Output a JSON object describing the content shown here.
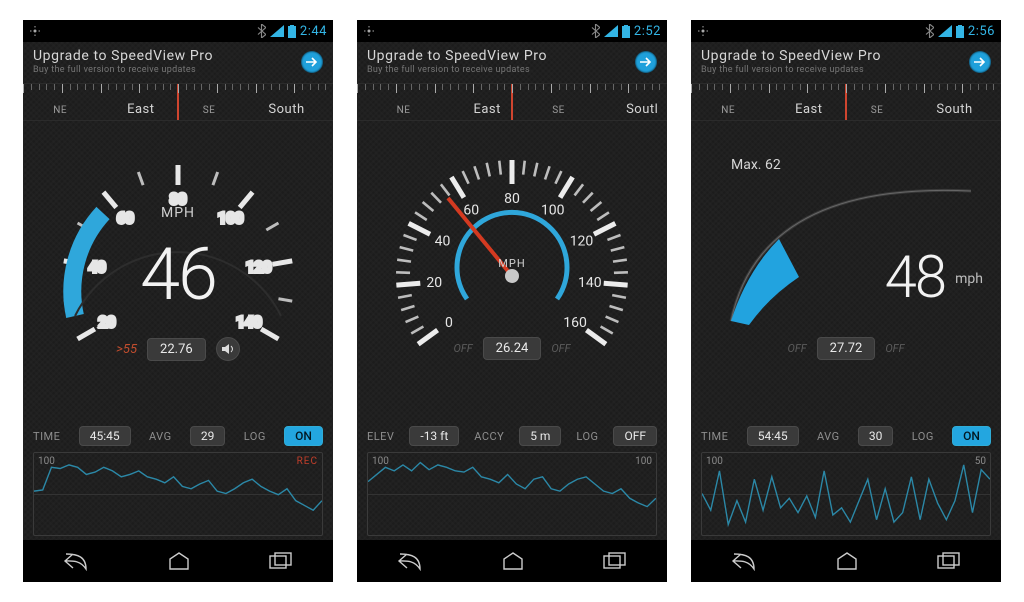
{
  "colors": {
    "accent": "#33b5e5",
    "warn": "#c04d2e"
  },
  "screens": [
    {
      "status": {
        "time": "2:44"
      },
      "upgrade": {
        "title": "Upgrade to SpeedView Pro",
        "subtitle": "Buy the full version to receive updates"
      },
      "compass": {
        "labels": [
          {
            "pos": 12,
            "text": "NE",
            "small": true
          },
          {
            "pos": 38,
            "text": "East"
          },
          {
            "pos": 60,
            "text": "SE",
            "small": true
          },
          {
            "pos": 85,
            "text": "South"
          }
        ]
      },
      "gauge": {
        "style": "digital",
        "unit": "MPH",
        "threshold": ">55",
        "ticks": [
          "20",
          "40",
          "60",
          "80",
          "100",
          "120",
          "140"
        ]
      },
      "speed": "46",
      "pill_center": "22.76",
      "horn": true,
      "stats": {
        "a_label": "TIME",
        "a_value": "45:45",
        "b_label": "AVG",
        "b_value": "29",
        "c_label": "LOG",
        "c_value": "ON",
        "c_on": true
      },
      "chart": {
        "ymax": "100",
        "right": "REC",
        "right_red": true,
        "points": [
          38,
          39,
          58,
          57,
          60,
          58,
          52,
          54,
          58,
          55,
          50,
          52,
          55,
          50,
          48,
          45,
          50,
          42,
          40,
          44,
          47,
          38,
          36,
          40,
          45,
          48,
          42,
          38,
          35,
          40,
          30,
          26,
          22,
          30
        ]
      }
    },
    {
      "status": {
        "time": "2:52"
      },
      "upgrade": {
        "title": "Upgrade to SpeedView Pro",
        "subtitle": "Buy the full version to receive updates"
      },
      "compass": {
        "labels": [
          {
            "pos": 15,
            "text": "NE",
            "small": true
          },
          {
            "pos": 42,
            "text": "East"
          },
          {
            "pos": 65,
            "text": "SE",
            "small": true
          },
          {
            "pos": 92,
            "text": "Soutl"
          }
        ]
      },
      "gauge": {
        "style": "needle",
        "unit": "MPH",
        "ticks": [
          "0",
          "20",
          "40",
          "60",
          "80",
          "100",
          "120",
          "140",
          "160"
        ]
      },
      "speed": "",
      "pill_center": "26.24",
      "horn": false,
      "ghost_off": true,
      "stats": {
        "a_label": "ELEV",
        "a_value": "-13 ft",
        "b_label": "ACCY",
        "b_value": "5 m",
        "c_label": "LOG",
        "c_value": "OFF",
        "c_on": false
      },
      "chart": {
        "ymax": "100",
        "right": "100",
        "points": [
          46,
          52,
          58,
          55,
          60,
          55,
          62,
          56,
          60,
          58,
          55,
          54,
          58,
          50,
          48,
          45,
          52,
          44,
          40,
          48,
          50,
          40,
          38,
          44,
          48,
          50,
          44,
          38,
          36,
          40,
          32,
          28,
          25,
          32
        ]
      }
    },
    {
      "status": {
        "time": "2:56"
      },
      "upgrade": {
        "title": "Upgrade to SpeedView Pro",
        "subtitle": "Buy the full version to receive updates"
      },
      "compass": {
        "labels": [
          {
            "pos": 12,
            "text": "NE",
            "small": true
          },
          {
            "pos": 38,
            "text": "East"
          },
          {
            "pos": 60,
            "text": "SE",
            "small": true
          },
          {
            "pos": 85,
            "text": "South"
          }
        ]
      },
      "gauge": {
        "style": "sweep",
        "unit": "mph",
        "max_label": "Max. 62"
      },
      "speed": "48",
      "pill_center": "27.72",
      "horn": false,
      "ghost_off": true,
      "stats": {
        "a_label": "TIME",
        "a_value": "54:45",
        "b_label": "AVG",
        "b_value": "30",
        "c_label": "LOG",
        "c_value": "ON",
        "c_on": true
      },
      "chart": {
        "ymax": "100",
        "right": "50",
        "points": [
          36,
          22,
          55,
          10,
          30,
          12,
          48,
          22,
          50,
          24,
          32,
          20,
          34,
          16,
          55,
          18,
          24,
          12,
          30,
          48,
          14,
          40,
          12,
          20,
          50,
          14,
          48,
          28,
          14,
          30,
          60,
          20,
          56,
          48
        ]
      }
    }
  ]
}
